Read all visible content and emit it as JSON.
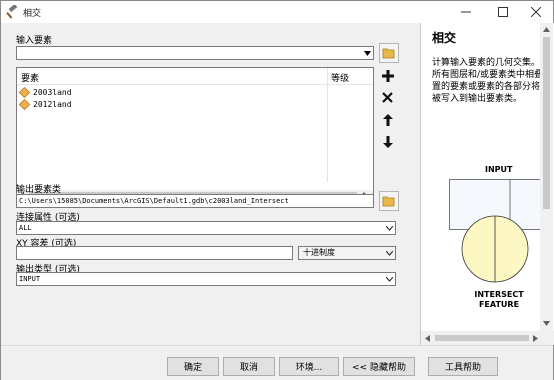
{
  "window": {
    "title": "相交",
    "icon": "hammer-icon",
    "controls": {
      "minimize": "minimize-icon",
      "maximize": "maximize-icon",
      "close": "close-icon"
    }
  },
  "form": {
    "input_features_label": "输入要素",
    "input_features_value": "",
    "table": {
      "columns": [
        "要素",
        "等级"
      ],
      "rows": [
        {
          "name": "2003land",
          "rank": ""
        },
        {
          "name": "2012land",
          "rank": ""
        }
      ]
    },
    "output_label": "输出要素类",
    "output_value": "C:\\Users\\15085\\Documents\\ArcGIS\\Default1.gdb\\c2003land_Intersect",
    "join_attr_label": "连接属性 (可选)",
    "join_attr_value": "ALL",
    "xy_tol_label": "XY 容差 (可选)",
    "xy_tol_value": "",
    "xy_tol_unit": "十进制度",
    "output_type_label": "输出类型 (可选)",
    "output_type_value": "INPUT"
  },
  "side_buttons": [
    "add-icon",
    "remove-icon",
    "move-up-icon",
    "move-down-icon"
  ],
  "help": {
    "title": "相交",
    "description": "计算输入要素的几何交集。所有图层和/或要素类中相叠置的要素或要素的各部分将被写入到输出要素类。",
    "diagram_top_label": "INPUT",
    "diagram_bottom_label": "INTERSECT FEATURE",
    "colors": {
      "circle_fill": "#fdf8c3",
      "circle_stroke": "#333333",
      "square_fill": "#f5f9fd"
    }
  },
  "buttons": {
    "ok": "确定",
    "cancel": "取消",
    "env": "环境...",
    "hide_help": "<< 隐藏帮助",
    "tool_help": "工具帮助"
  }
}
